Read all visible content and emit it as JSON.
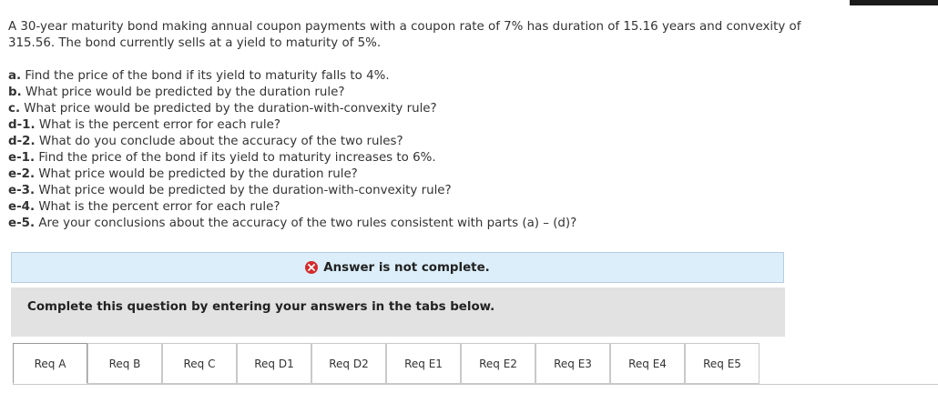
{
  "question": {
    "text": "A 30-year maturity bond making annual coupon payments with a coupon rate of 7% has duration of 15.16 years and convexity of 315.56. The bond currently sells at a yield to maturity of 5%."
  },
  "parts": [
    {
      "label": "a.",
      "text": "Find the price of the bond if its yield to maturity falls to 4%."
    },
    {
      "label": "b.",
      "text": "What price would be predicted by the duration rule?"
    },
    {
      "label": "c.",
      "text": "What price would be predicted by the duration-with-convexity rule?"
    },
    {
      "label": "d-1.",
      "text": "What is the percent error for each rule?"
    },
    {
      "label": "d-2.",
      "text": "What do you conclude about the accuracy of the two rules?"
    },
    {
      "label": "e-1.",
      "text": "Find the price of the bond if its yield to maturity increases to 6%."
    },
    {
      "label": "e-2.",
      "text": "What price would be predicted by the duration rule?"
    },
    {
      "label": "e-3.",
      "text": "What price would be predicted by the duration-with-convexity rule?"
    },
    {
      "label": "e-4.",
      "text": "What is the percent error for each rule?"
    },
    {
      "label": "e-5.",
      "text": "Are your conclusions about the accuracy of the two rules consistent with parts (a) – (d)?"
    }
  ],
  "status": {
    "icon": "x-circle-icon",
    "icon_color": "#d42b2b",
    "text": "Answer is not complete."
  },
  "instructions": {
    "text": "Complete this question by entering your answers in the tabs below."
  },
  "tabs": [
    {
      "label": "Req A",
      "active": true
    },
    {
      "label": "Req B"
    },
    {
      "label": "Req C"
    },
    {
      "label": "Req D1"
    },
    {
      "label": "Req D2"
    },
    {
      "label": "Req E1"
    },
    {
      "label": "Req E2"
    },
    {
      "label": "Req E3"
    },
    {
      "label": "Req E4"
    },
    {
      "label": "Req E5"
    }
  ]
}
